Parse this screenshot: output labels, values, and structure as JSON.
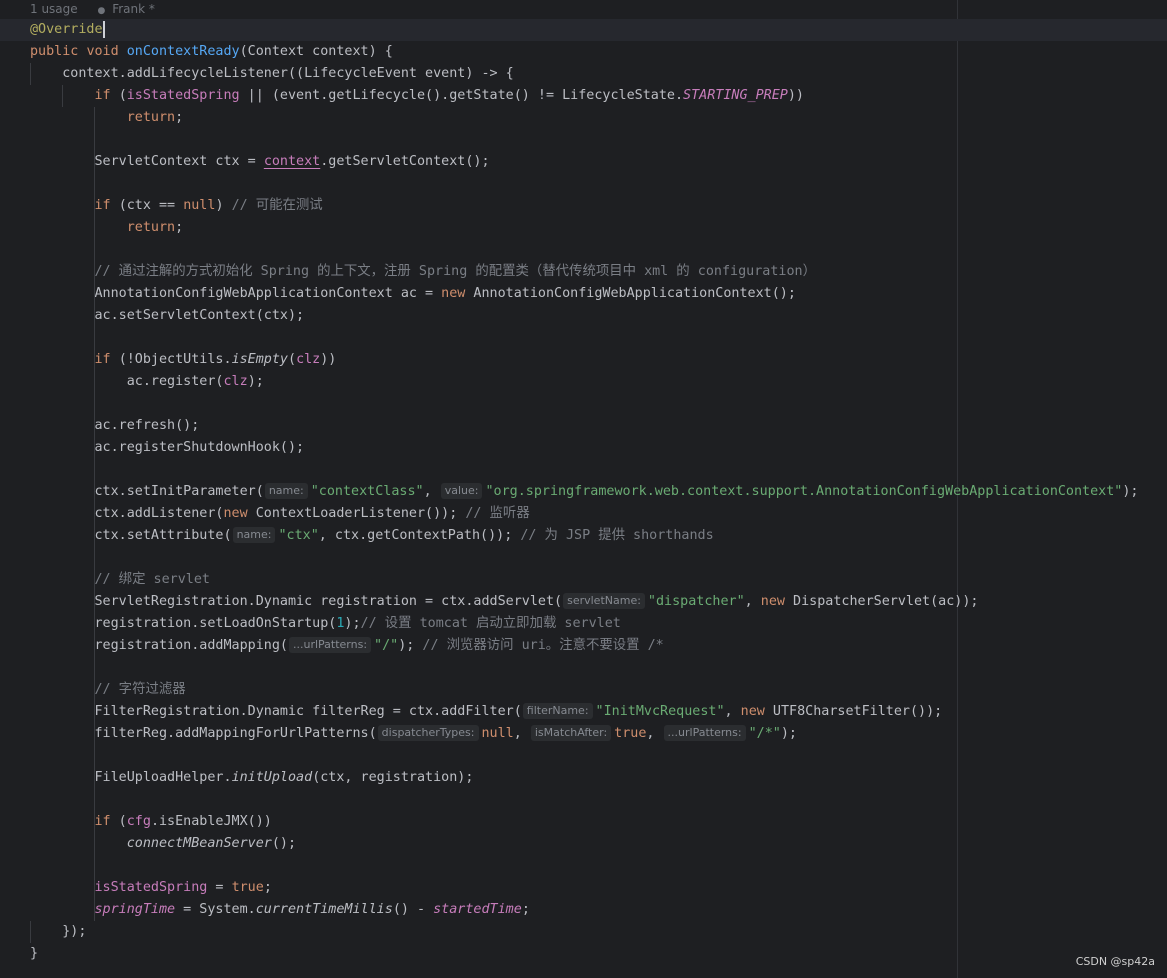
{
  "header": {
    "usages": "1 usage",
    "author": "Frank *",
    "author_icon": "user-icon"
  },
  "watermark": "CSDN @sp42a",
  "code": {
    "l1": "@Override",
    "l2": [
      "public",
      "void",
      "onContextReady",
      "(Context context) {"
    ],
    "l3": "context.addLifecycleListener((LifecycleEvent event) -> {",
    "l4": [
      "if",
      "(",
      "isStatedSpring",
      " || (event.getLifecycle().getState() != LifecycleState.",
      "STARTING_PREP",
      "))"
    ],
    "l5": [
      "return",
      ";"
    ],
    "l7": [
      "ServletContext ctx = ",
      "context",
      ".getServletContext();"
    ],
    "l9": [
      "if",
      "(ctx == ",
      "null",
      ") ",
      "// 可能在测试"
    ],
    "l10": [
      "return",
      ";"
    ],
    "l12": "// 通过注解的方式初始化 Spring 的上下文，注册 Spring 的配置类（替代传统项目中 xml 的 configuration）",
    "l13": [
      "AnnotationConfigWebApplicationContext ac = ",
      "new",
      " AnnotationConfigWebApplicationContext();"
    ],
    "l14": "ac.setServletContext(ctx);",
    "l16": [
      "if",
      "(!ObjectUtils.",
      "isEmpty",
      "(",
      "clz",
      "))"
    ],
    "l17": [
      "ac.register(",
      "clz",
      ");"
    ],
    "l19": "ac.refresh();",
    "l20": "ac.registerShutdownHook();",
    "l22": [
      "ctx.setInitParameter(",
      "name:",
      "\"contextClass\"",
      ", ",
      "value:",
      "\"org.springframework.web.context.support.AnnotationConfigWebApplicationContext\"",
      ");"
    ],
    "l23": [
      "ctx.addListener(",
      "new",
      " ContextLoaderListener()); ",
      "// 监听器"
    ],
    "l24": [
      "ctx.setAttribute(",
      "name:",
      "\"ctx\"",
      ", ctx.getContextPath()); ",
      "// 为 JSP 提供 shorthands"
    ],
    "l26": "// 绑定 servlet",
    "l27": [
      "ServletRegistration.Dynamic registration = ctx.addServlet(",
      "servletName:",
      "\"dispatcher\"",
      ", ",
      "new",
      " DispatcherServlet(ac));"
    ],
    "l28": [
      "registration.setLoadOnStartup(",
      "1",
      ");",
      "// 设置 tomcat 启动立即加载 servlet"
    ],
    "l29": [
      "registration.addMapping(",
      "...urlPatterns:",
      "\"/\"",
      "); ",
      "// 浏览器访问 uri。注意不要设置 /*"
    ],
    "l31": "// 字符过滤器",
    "l32": [
      "FilterRegistration.Dynamic filterReg = ctx.addFilter(",
      "filterName:",
      "\"InitMvcRequest\"",
      ", ",
      "new",
      " UTF8CharsetFilter());"
    ],
    "l33": [
      "filterReg.addMappingForUrlPatterns(",
      "dispatcherTypes:",
      "null",
      ", ",
      "isMatchAfter:",
      "true",
      ", ",
      "...urlPatterns:",
      "\"/*\"",
      ");"
    ],
    "l35": [
      "FileUploadHelper.",
      "initUpload",
      "(ctx, registration);"
    ],
    "l37": [
      "if",
      " (",
      "cfg",
      ".isEnableJMX())"
    ],
    "l38": [
      "connectMBeanServer",
      "();"
    ],
    "l40": [
      "isStatedSpring",
      " = ",
      "true",
      ";"
    ],
    "l41": [
      "springTime",
      " = System.",
      "currentTimeMillis",
      "() - ",
      "startedTime",
      ";"
    ],
    "l42": "});",
    "l43": "}"
  }
}
